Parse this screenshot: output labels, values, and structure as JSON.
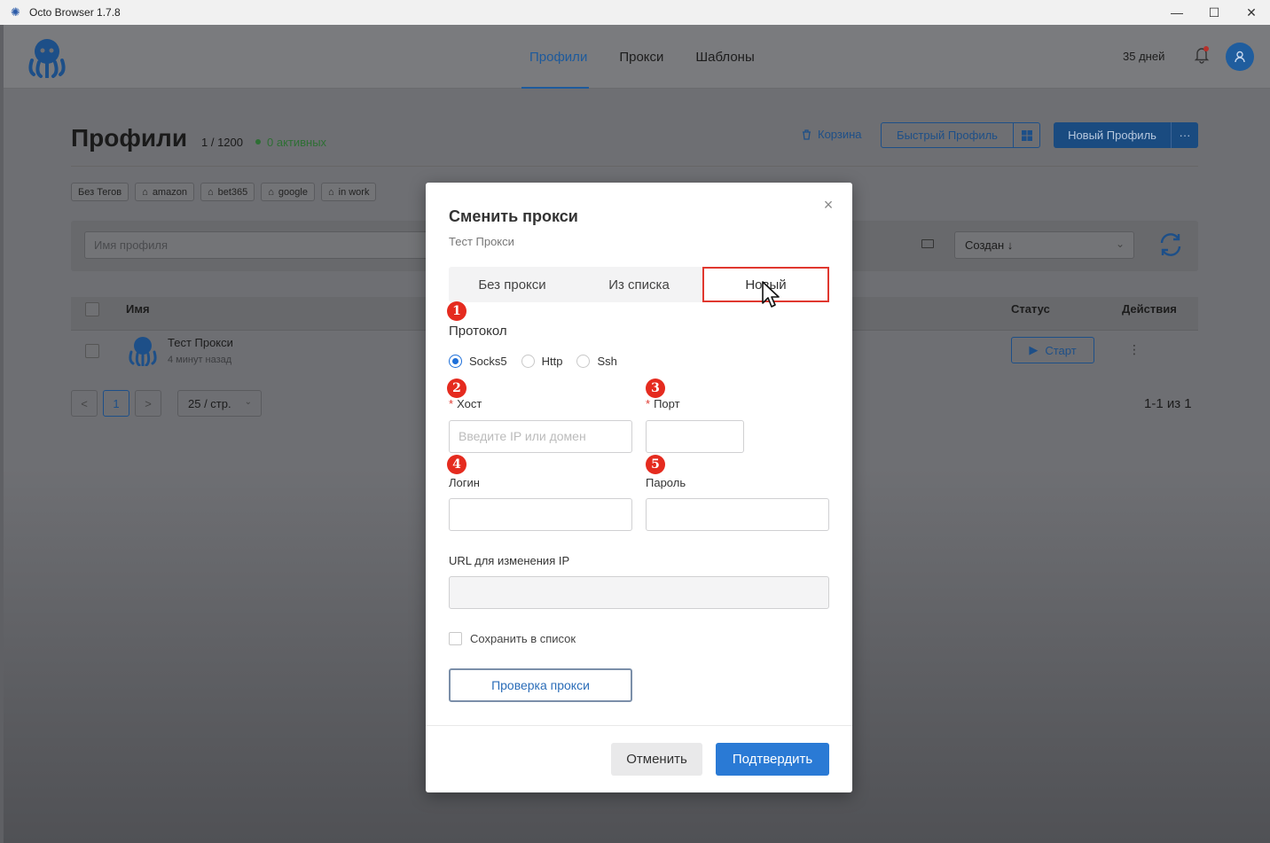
{
  "window": {
    "title": "Octo Browser 1.7.8",
    "controls": [
      "minimize",
      "maximize",
      "close"
    ]
  },
  "header": {
    "nav": [
      "Профили",
      "Прокси",
      "Шаблоны"
    ],
    "active_nav": "Профили",
    "days_left": "35 дней"
  },
  "page": {
    "title": "Профили",
    "count": "1 / 1200",
    "active": "0 активных",
    "trash": "Корзина",
    "quick_profile": "Быстрый Профиль",
    "new_profile": "Новый Профиль",
    "more": "···",
    "tags": [
      "Без Тегов",
      "amazon",
      "bet365",
      "google",
      "in work"
    ],
    "search_placeholder": "Имя профиля",
    "sort": "Создан ↓",
    "columns": {
      "name": "Имя",
      "status": "Статус",
      "actions": "Действия"
    },
    "rows": [
      {
        "name": "Тест Прокси",
        "time": "4 минут назад",
        "start": "Старт"
      }
    ],
    "pagination": {
      "prev": "<",
      "page": "1",
      "next": ">",
      "per_page": "25 / стр.",
      "range": "1-1 из 1"
    }
  },
  "modal": {
    "title": "Сменить прокси",
    "subtitle": "Тест Прокси",
    "tabs": [
      "Без прокси",
      "Из списка",
      "Новый"
    ],
    "active_tab": "Новый",
    "protocol_label": "Протокол",
    "protocols": [
      "Socks5",
      "Http",
      "Ssh"
    ],
    "selected_protocol": "Socks5",
    "host_label": "Хост",
    "host_placeholder": "Введите IP или домен",
    "port_label": "Порт",
    "login_label": "Логин",
    "password_label": "Пароль",
    "url_label": "URL для изменения IP",
    "save_label": "Сохранить в список",
    "check_label": "Проверка прокси",
    "cancel": "Отменить",
    "confirm": "Подтвердить",
    "badges": [
      "1",
      "2",
      "3",
      "4",
      "5"
    ]
  },
  "colors": {
    "accent": "#2a7ad5",
    "badge": "#e52b1f",
    "highlight": "#e0382f"
  }
}
